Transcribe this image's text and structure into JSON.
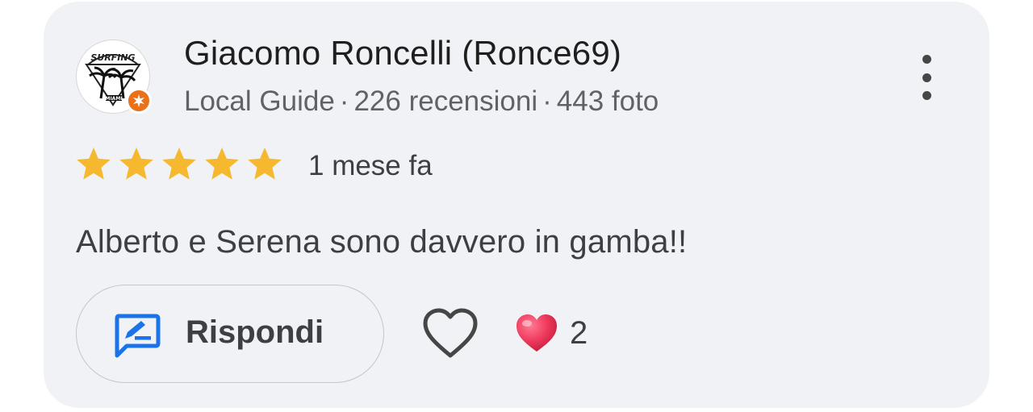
{
  "author": {
    "name": "Giacomo Roncelli (Ronce69)",
    "level": "Local Guide",
    "reviews": "226 recensioni",
    "photos": "443 foto",
    "separator": "·",
    "avatar_text": "SURFING MIAMI",
    "badge_color": "#e8711a"
  },
  "review": {
    "rating": 5,
    "max_rating": 5,
    "star_color": "#f5b82e",
    "time": "1 mese fa",
    "text": "Alberto e Serena sono davvero in gamba!!"
  },
  "actions": {
    "reply_label": "Rispondi",
    "reply_icon": "reply-edit-icon",
    "reply_icon_color": "#1a73e8",
    "like_icon": "heart-outline-icon",
    "reaction_icon": "red-heart-icon",
    "reaction_count": "2",
    "more_icon": "more-vertical-icon"
  }
}
